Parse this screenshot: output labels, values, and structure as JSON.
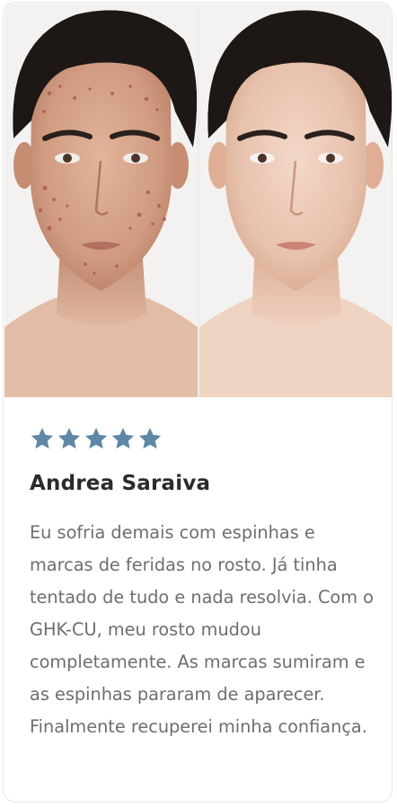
{
  "testimonial": {
    "rating": 5,
    "rating_max": 5,
    "star_color": "#5f87a6",
    "name": "Andrea Saraiva",
    "review": "Eu sofria demais com espinhas e marcas de feridas no rosto. Já tinha tentado de tudo e nada resolvia. Com o GHK-CU, meu rosto mudou completamente. As marcas sumiram e as espinhas pararam de aparecer. Finalmente recuperei minha confiança."
  },
  "images": {
    "before": "face-with-acne-photo",
    "after": "clear-skin-face-photo"
  }
}
